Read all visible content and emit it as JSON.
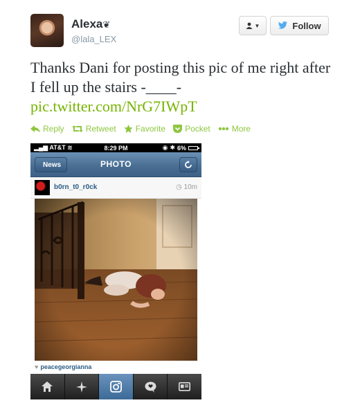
{
  "tweet": {
    "author_name": "Alexa",
    "author_handle": "@lala_LEX",
    "follow_label": "Follow",
    "text": "Thanks Dani for posting this pic of me right after I fell up the stairs -____-",
    "link": "pic.twitter.com/NrG7IWpT"
  },
  "actions": [
    {
      "label": "Reply",
      "icon": "reply-icon"
    },
    {
      "label": "Retweet",
      "icon": "retweet-icon"
    },
    {
      "label": "Favorite",
      "icon": "star-icon"
    },
    {
      "label": "Pocket",
      "icon": "pocket-icon"
    },
    {
      "label": "More",
      "icon": "more-dots-icon"
    }
  ],
  "embedded_screenshot": {
    "status_bar": {
      "carrier": "AT&T",
      "time": "8:29 PM",
      "battery": "6%"
    },
    "nav": {
      "back_label": "News",
      "title": "PHOTO"
    },
    "post": {
      "username": "b0rn_t0_r0ck",
      "time": "10m",
      "liked_by": "peacegeorgianna"
    },
    "tabs": [
      "home-icon",
      "explore-icon",
      "camera-icon",
      "activity-icon",
      "profile-icon"
    ]
  },
  "colors": {
    "accent_green": "#75b300",
    "twitter_blue": "#55acee",
    "nav_blue": "#4a6f93"
  }
}
